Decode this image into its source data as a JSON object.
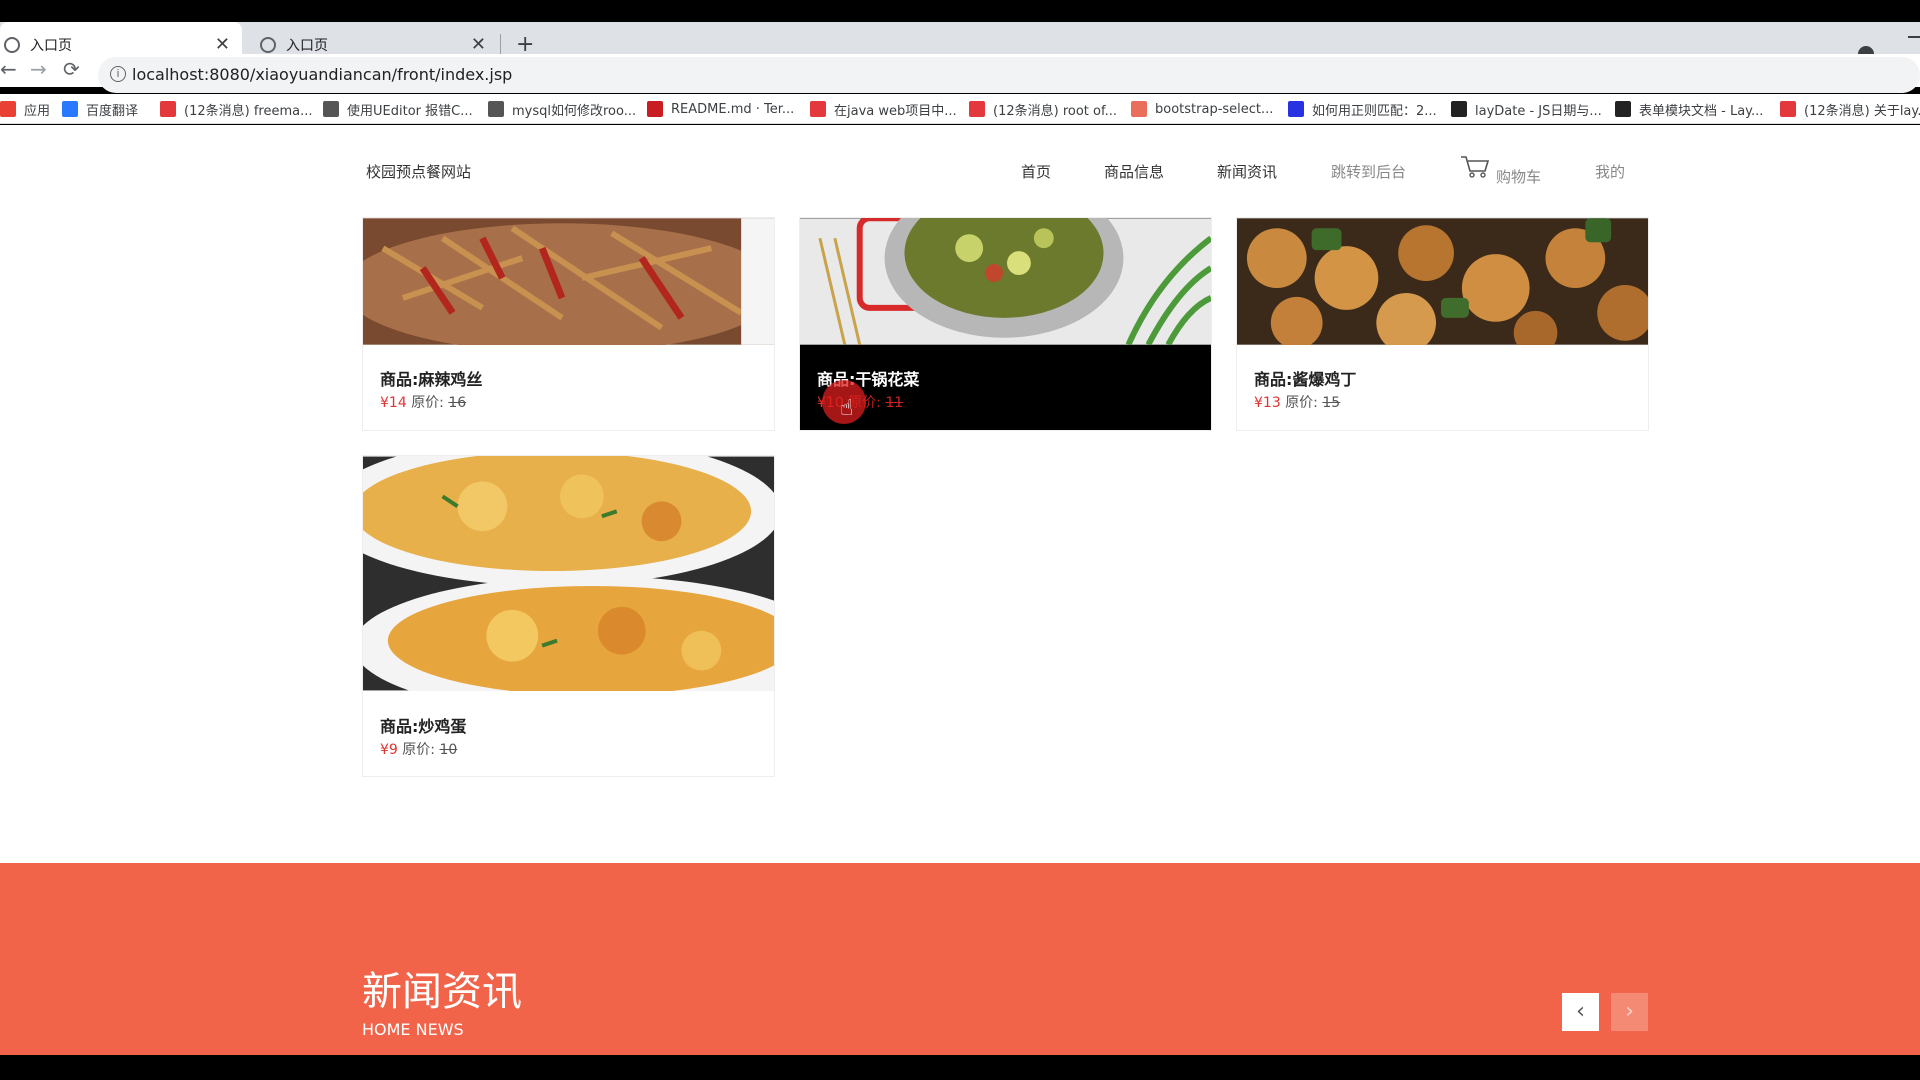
{
  "browser": {
    "tabs": [
      {
        "title": "入口页",
        "active": true
      },
      {
        "title": "入口页",
        "active": false
      }
    ],
    "new_tab": "+",
    "nav": {
      "back": "←",
      "forward": "→",
      "reload": "⟳"
    },
    "url": "localhost:8080/xiaoyuandiancan/front/index.jsp",
    "bookmarks": [
      {
        "label": "应用",
        "icon": "apps-grid-icon",
        "color": "#e94235"
      },
      {
        "label": "百度翻译",
        "icon": "baidu-translate-icon",
        "color": "#2979ff"
      },
      {
        "label": "(12条消息) freema...",
        "icon": "csdn-icon",
        "color": "#e4393c"
      },
      {
        "label": "使用UEditor 报错C...",
        "icon": "web-icon",
        "color": "#555555"
      },
      {
        "label": "mysql如何修改roo...",
        "icon": "web-icon",
        "color": "#555555"
      },
      {
        "label": "README.md · Ter...",
        "icon": "gitee-icon",
        "color": "#c71d23"
      },
      {
        "label": "在java web项目中...",
        "icon": "csdn-icon",
        "color": "#e4393c"
      },
      {
        "label": "(12条消息) root of...",
        "icon": "csdn-icon",
        "color": "#e4393c"
      },
      {
        "label": "bootstrap-select...",
        "icon": "jianshu-icon",
        "color": "#ea6f5a"
      },
      {
        "label": "如何用正则匹配：2...",
        "icon": "baidu-icon",
        "color": "#2932e1"
      },
      {
        "label": "layDate - JS日期与...",
        "icon": "layui-icon",
        "color": "#222222"
      },
      {
        "label": "表单模块文档 - Lay...",
        "icon": "layui-icon",
        "color": "#222222"
      },
      {
        "label": "(12条消息) 关于lay...",
        "icon": "csdn-icon",
        "color": "#e4393c"
      }
    ]
  },
  "site": {
    "title": "校园预点餐网站",
    "nav": [
      "首页",
      "商品信息",
      "新闻资讯",
      "跳转到后台",
      "购物车",
      "我的"
    ]
  },
  "products": [
    {
      "name": "商品:麻辣鸡丝",
      "price": "¥14",
      "old_label": "原价:",
      "old_price": "16",
      "hover": false
    },
    {
      "name": "商品:干锅花菜",
      "price": "¥10",
      "old_label": "原价:",
      "old_price": "11",
      "hover": true
    },
    {
      "name": "商品:酱爆鸡丁",
      "price": "¥13",
      "old_label": "原价:",
      "old_price": "15",
      "hover": false
    },
    {
      "name": "商品:炒鸡蛋",
      "price": "¥9",
      "old_label": "原价:",
      "old_price": "10",
      "hover": false
    }
  ],
  "news": {
    "title": "新闻资讯",
    "subtitle": "HOME NEWS",
    "prev": "‹",
    "next": "›"
  },
  "colors": {
    "accent": "#f2644a",
    "price": "#e23232"
  }
}
